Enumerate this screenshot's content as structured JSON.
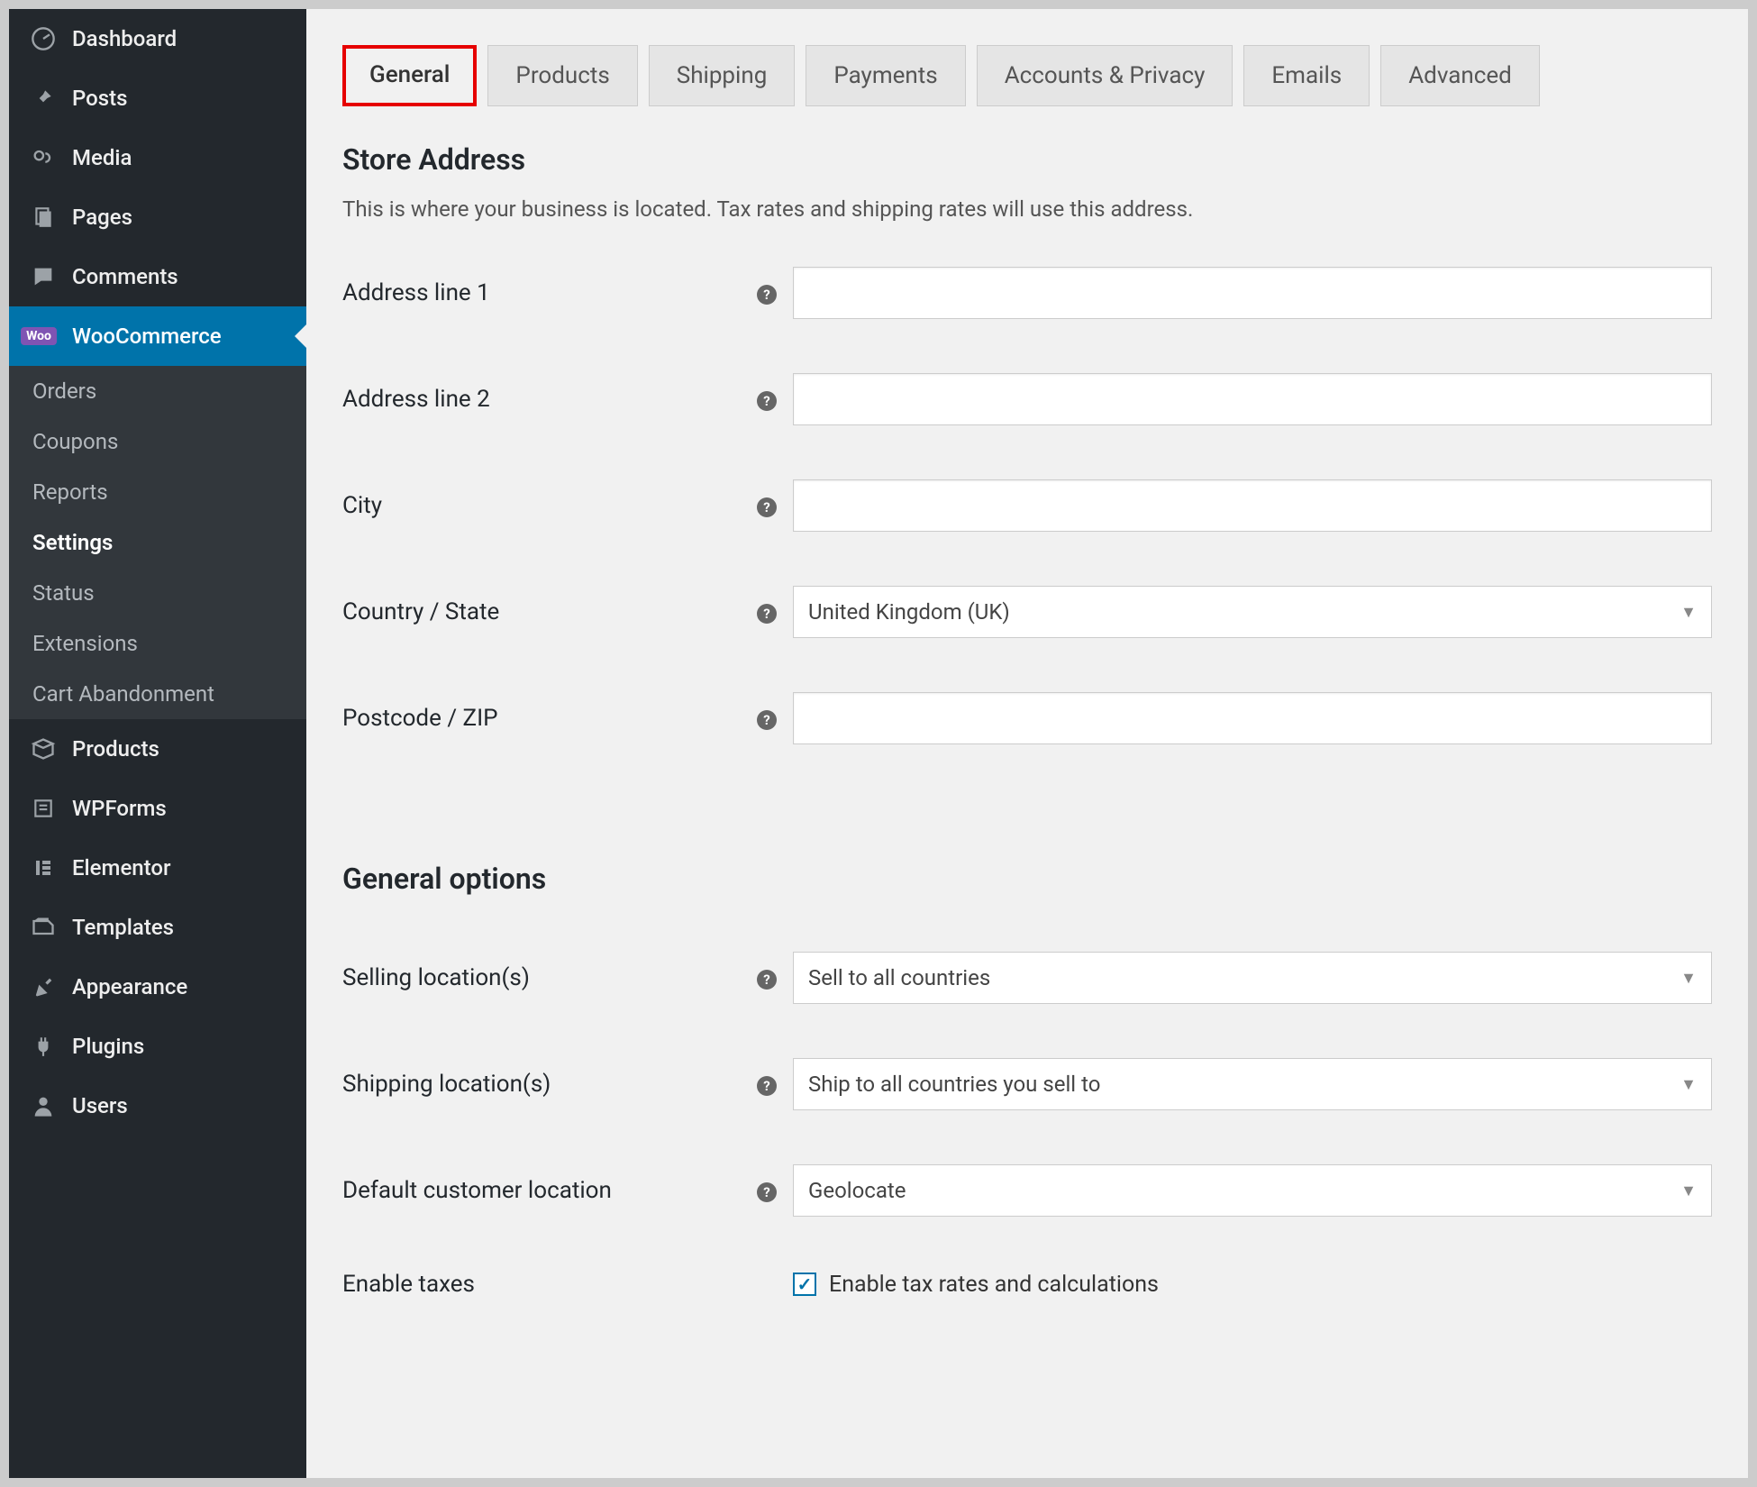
{
  "sidebar": {
    "items": [
      {
        "label": "Dashboard",
        "icon": "dashboard"
      },
      {
        "label": "Posts",
        "icon": "pin"
      },
      {
        "label": "Media",
        "icon": "media"
      },
      {
        "label": "Pages",
        "icon": "pages"
      },
      {
        "label": "Comments",
        "icon": "comment"
      },
      {
        "label": "WooCommerce",
        "icon": "woo",
        "active": true
      },
      {
        "label": "Products",
        "icon": "products"
      },
      {
        "label": "WPForms",
        "icon": "wpforms"
      },
      {
        "label": "Elementor",
        "icon": "elementor"
      },
      {
        "label": "Templates",
        "icon": "templates"
      },
      {
        "label": "Appearance",
        "icon": "appearance"
      },
      {
        "label": "Plugins",
        "icon": "plugins"
      },
      {
        "label": "Users",
        "icon": "users"
      }
    ],
    "woo_badge": "Woo",
    "submenu": [
      {
        "label": "Orders"
      },
      {
        "label": "Coupons"
      },
      {
        "label": "Reports"
      },
      {
        "label": "Settings",
        "current": true
      },
      {
        "label": "Status"
      },
      {
        "label": "Extensions"
      },
      {
        "label": "Cart Abandonment"
      }
    ]
  },
  "tabs": [
    {
      "label": "General",
      "active": true
    },
    {
      "label": "Products"
    },
    {
      "label": "Shipping"
    },
    {
      "label": "Payments"
    },
    {
      "label": "Accounts & Privacy"
    },
    {
      "label": "Emails"
    },
    {
      "label": "Advanced"
    }
  ],
  "store_address": {
    "title": "Store Address",
    "description": "This is where your business is located. Tax rates and shipping rates will use this address.",
    "fields": {
      "address1_label": "Address line 1",
      "address1_value": "",
      "address2_label": "Address line 2",
      "address2_value": "",
      "city_label": "City",
      "city_value": "",
      "country_label": "Country / State",
      "country_value": "United Kingdom (UK)",
      "postcode_label": "Postcode / ZIP",
      "postcode_value": ""
    }
  },
  "general_options": {
    "title": "General options",
    "selling_label": "Selling location(s)",
    "selling_value": "Sell to all countries",
    "shipping_label": "Shipping location(s)",
    "shipping_value": "Ship to all countries you sell to",
    "default_loc_label": "Default customer location",
    "default_loc_value": "Geolocate",
    "enable_taxes_label": "Enable taxes",
    "enable_taxes_checkbox_label": "Enable tax rates and calculations",
    "enable_taxes_checked": true
  }
}
